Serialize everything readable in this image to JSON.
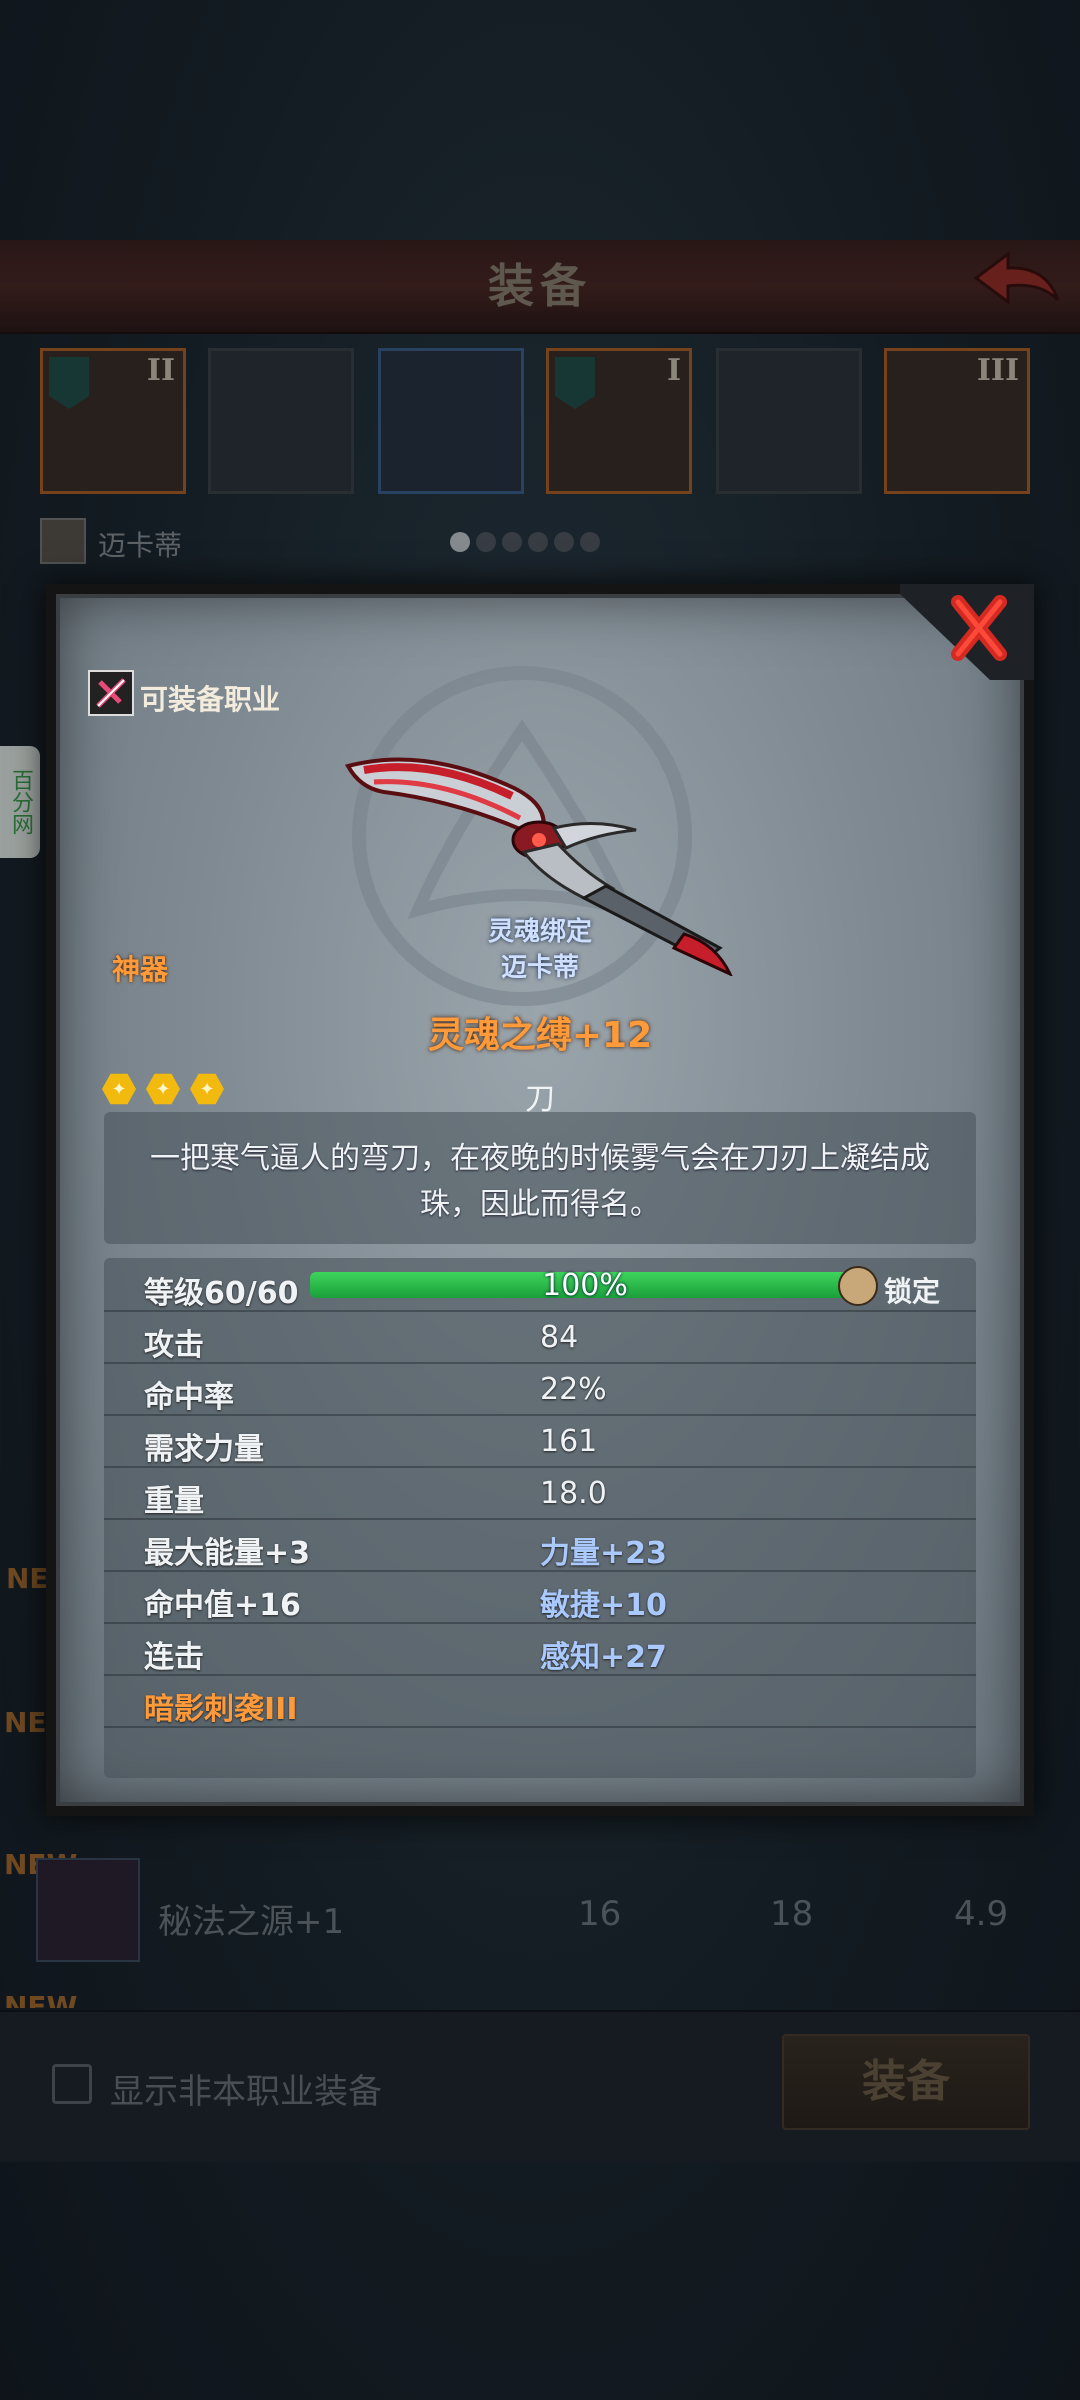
{
  "screen": {
    "title": "装备",
    "character_name": "迈卡蒂",
    "side_tag": "百分网",
    "slots": [
      {
        "roman": "II",
        "style": "orange",
        "badge": true
      },
      {
        "roman": "",
        "style": "empty",
        "badge": false
      },
      {
        "roman": "",
        "style": "blue",
        "badge": false
      },
      {
        "roman": "I",
        "style": "orange",
        "badge": true
      },
      {
        "roman": "",
        "style": "empty",
        "badge": false
      },
      {
        "roman": "III",
        "style": "orange",
        "badge": false
      }
    ],
    "page_dots": {
      "count": 6,
      "active": 0
    },
    "new_tags": [
      "NEW",
      "NEW",
      "NEW",
      "NEW"
    ],
    "list_item": {
      "name": "秘法之源+1",
      "values": [
        "16",
        "18",
        "4.9"
      ]
    },
    "show_other_class_label": "显示非本职业装备",
    "equip_button": "装备"
  },
  "popup": {
    "class_label": "可装备职业",
    "rarity": "神器",
    "soulbound_line1": "灵魂绑定",
    "soulbound_line2": "迈卡蒂",
    "item_name": "灵魂之缚+12",
    "item_type": "刀",
    "stars": 3,
    "description": "一把寒气逼人的弯刀，在夜晚的时候雾气会在刀刃上凝结成珠，因此而得名。",
    "level_label": "等级60/60",
    "level_percent_text": "100%",
    "level_fraction": 1.0,
    "lock_label": "锁定",
    "stats": [
      {
        "left": "攻击",
        "right": "84",
        "left_style": "white",
        "right_style": "white"
      },
      {
        "left": "命中率",
        "right": "22%",
        "left_style": "white",
        "right_style": "white"
      },
      {
        "left": "需求力量",
        "right": "161",
        "left_style": "white",
        "right_style": "white"
      },
      {
        "left": "重量",
        "right": "18.0",
        "left_style": "white",
        "right_style": "white"
      },
      {
        "left": "最大能量+3",
        "right": "力量+23",
        "left_style": "white",
        "right_style": "blue"
      },
      {
        "left": "命中值+16",
        "right": "敏捷+10",
        "left_style": "white",
        "right_style": "blue"
      },
      {
        "left": "连击",
        "right": "感知+27",
        "left_style": "white",
        "right_style": "blue"
      },
      {
        "left": "暗影刺袭III",
        "right": "",
        "left_style": "orange",
        "right_style": "white"
      }
    ]
  },
  "colors": {
    "accent_orange": "#ff9a3a",
    "bonus_blue": "#a9c9ff",
    "bar_green": "#2ec04c"
  }
}
